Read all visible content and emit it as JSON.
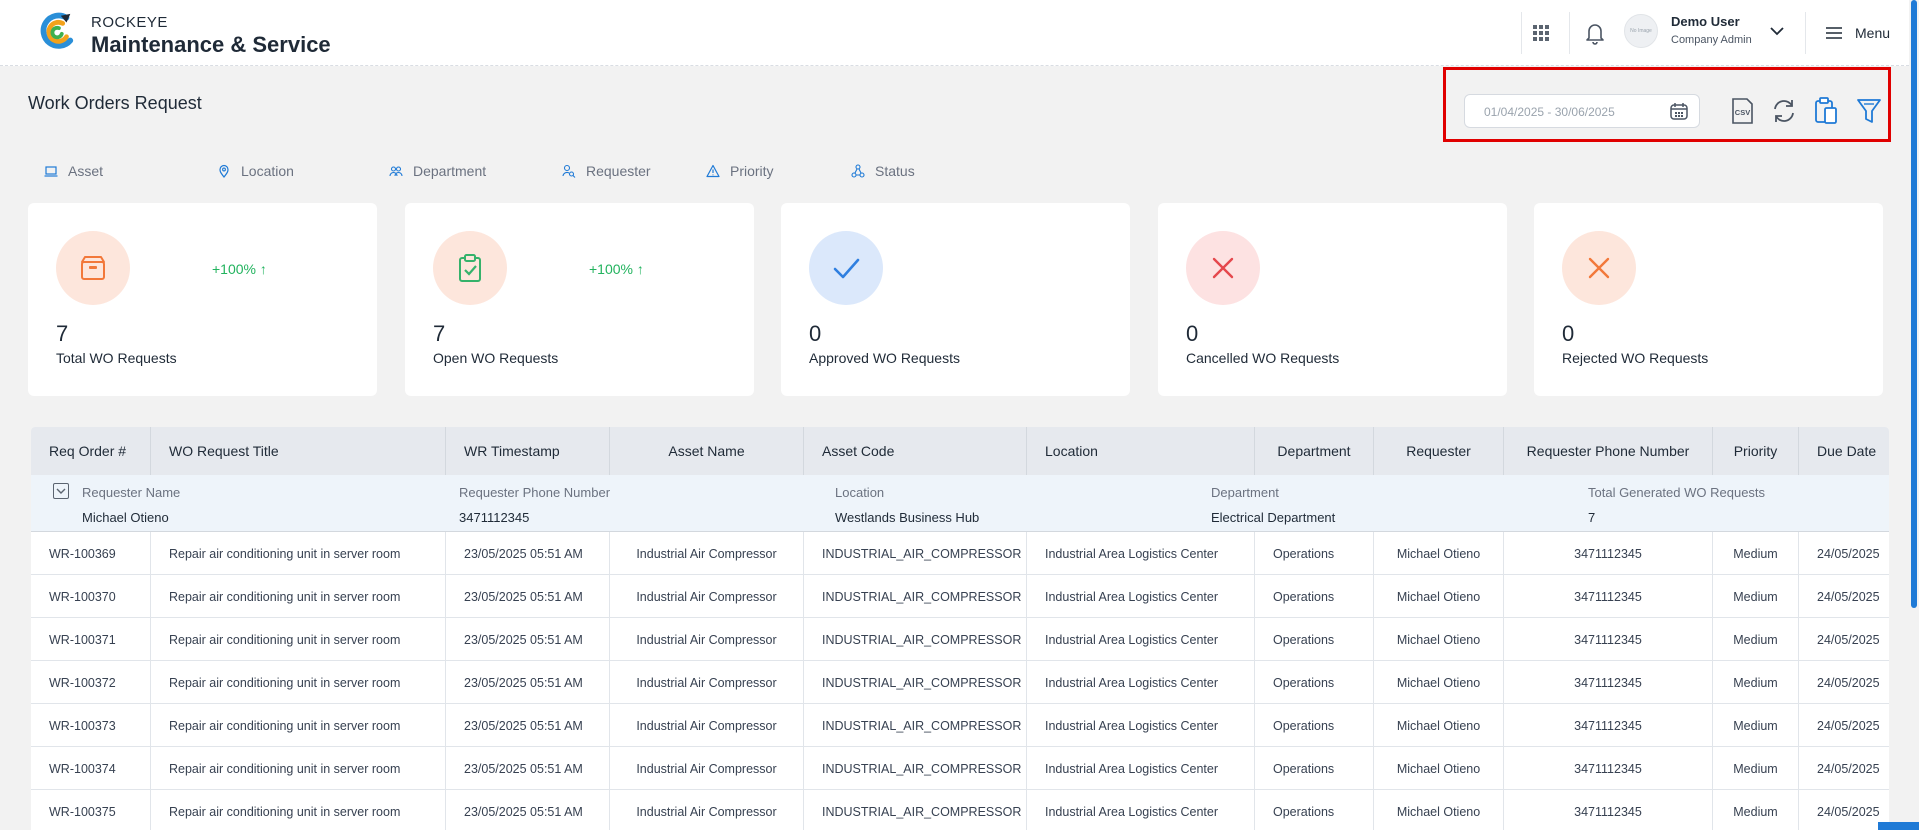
{
  "header": {
    "brand_small": "ROCKEYE",
    "brand_big": "Maintenance & Service",
    "user_name": "Demo User",
    "user_role": "Company Admin",
    "avatar_text": "No Image",
    "menu_label": "Menu"
  },
  "page": {
    "title": "Work Orders Request",
    "date_range_placeholder": "01/04/2025 - 30/06/2025"
  },
  "toolbar": {
    "icons": [
      "calendar-icon",
      "csv-export-icon",
      "refresh-icon",
      "clipboard-icon",
      "filter-icon"
    ]
  },
  "filters": [
    {
      "label": "Asset",
      "icon": "laptop-icon"
    },
    {
      "label": "Location",
      "icon": "location-pin-icon"
    },
    {
      "label": "Department",
      "icon": "users-icon"
    },
    {
      "label": "Requester",
      "icon": "user-search-icon"
    },
    {
      "label": "Priority",
      "icon": "warning-triangle-icon"
    },
    {
      "label": "Status",
      "icon": "network-icon"
    }
  ],
  "cards": [
    {
      "count": "7",
      "label": "Total WO Requests",
      "trend": "+100% ↑",
      "icon": "box-icon",
      "icon_color": "#f2783a",
      "icon_bg": "#fde6dc"
    },
    {
      "count": "7",
      "label": "Open WO Requests",
      "trend": "+100% ↑",
      "icon": "clipboard-check-icon",
      "icon_color": "#35b26b",
      "icon_bg": "#fde6dc"
    },
    {
      "count": "0",
      "label": "Approved WO Requests",
      "trend": "",
      "icon": "check-icon",
      "icon_color": "#2f7fe0",
      "icon_bg": "#dbe8fb"
    },
    {
      "count": "0",
      "label": "Cancelled WO Requests",
      "trend": "",
      "icon": "x-icon",
      "icon_color": "#e5484d",
      "icon_bg": "#fde2e2"
    },
    {
      "count": "0",
      "label": "Rejected WO Requests",
      "trend": "",
      "icon": "x-icon",
      "icon_color": "#f2783a",
      "icon_bg": "#fde6dc"
    }
  ],
  "table": {
    "columns": [
      "Req Order #",
      "WO Request Title",
      "WR Timestamp",
      "Asset Name",
      "Asset Code",
      "Location",
      "Department",
      "Requester",
      "Requester Phone Number",
      "Priority",
      "Due Date"
    ],
    "group": {
      "labels": [
        "Requester Name",
        "Requester Phone Number",
        "Location",
        "Department",
        "Total Generated WO Requests"
      ],
      "values": [
        "Michael Otieno",
        "3471112345",
        "Westlands Business Hub",
        "Electrical Department",
        "7"
      ]
    },
    "rows": [
      [
        "WR-100369",
        "Repair air conditioning unit in server room",
        "23/05/2025 05:51 AM",
        "Industrial Air Compressor",
        "INDUSTRIAL_AIR_COMPRESSOR",
        "Industrial Area Logistics Center",
        "Operations",
        "Michael Otieno",
        "3471112345",
        "Medium",
        "24/05/2025"
      ],
      [
        "WR-100370",
        "Repair air conditioning unit in server room",
        "23/05/2025 05:51 AM",
        "Industrial Air Compressor",
        "INDUSTRIAL_AIR_COMPRESSOR",
        "Industrial Area Logistics Center",
        "Operations",
        "Michael Otieno",
        "3471112345",
        "Medium",
        "24/05/2025"
      ],
      [
        "WR-100371",
        "Repair air conditioning unit in server room",
        "23/05/2025 05:51 AM",
        "Industrial Air Compressor",
        "INDUSTRIAL_AIR_COMPRESSOR",
        "Industrial Area Logistics Center",
        "Operations",
        "Michael Otieno",
        "3471112345",
        "Medium",
        "24/05/2025"
      ],
      [
        "WR-100372",
        "Repair air conditioning unit in server room",
        "23/05/2025 05:51 AM",
        "Industrial Air Compressor",
        "INDUSTRIAL_AIR_COMPRESSOR",
        "Industrial Area Logistics Center",
        "Operations",
        "Michael Otieno",
        "3471112345",
        "Medium",
        "24/05/2025"
      ],
      [
        "WR-100373",
        "Repair air conditioning unit in server room",
        "23/05/2025 05:51 AM",
        "Industrial Air Compressor",
        "INDUSTRIAL_AIR_COMPRESSOR",
        "Industrial Area Logistics Center",
        "Operations",
        "Michael Otieno",
        "3471112345",
        "Medium",
        "24/05/2025"
      ],
      [
        "WR-100374",
        "Repair air conditioning unit in server room",
        "23/05/2025 05:51 AM",
        "Industrial Air Compressor",
        "INDUSTRIAL_AIR_COMPRESSOR",
        "Industrial Area Logistics Center",
        "Operations",
        "Michael Otieno",
        "3471112345",
        "Medium",
        "24/05/2025"
      ],
      [
        "WR-100375",
        "Repair air conditioning unit in server room",
        "23/05/2025 05:51 AM",
        "Industrial Air Compressor",
        "INDUSTRIAL_AIR_COMPRESSOR",
        "Industrial Area Logistics Center",
        "Operations",
        "Michael Otieno",
        "3471112345",
        "Medium",
        "24/05/2025"
      ]
    ]
  },
  "colors": {
    "accent": "#1f7ad6",
    "highlight_border": "#e00000",
    "trend_up": "#22b35e"
  }
}
